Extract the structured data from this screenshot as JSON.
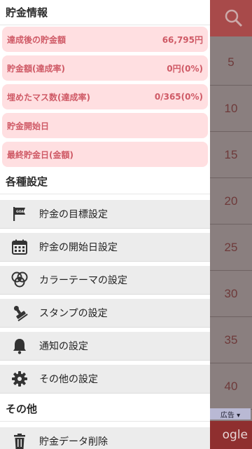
{
  "background": {
    "numbers": [
      "5",
      "10",
      "15",
      "20",
      "25",
      "30",
      "35",
      "40"
    ],
    "ad_label": "広告 ▾",
    "google_text": "ogle"
  },
  "savings_info": {
    "title": "貯金情報",
    "rows": [
      {
        "label": "達成後の貯金額",
        "value": "66,795円"
      },
      {
        "label": "貯金額(達成率)",
        "value": "0円(0%)"
      },
      {
        "label": "埋めたマス数(達成率)",
        "value": "0/365(0%)"
      },
      {
        "label": "貯金開始日",
        "value": ""
      },
      {
        "label": "最終貯金日(金額)",
        "value": ""
      }
    ]
  },
  "settings": {
    "title": "各種設定",
    "items": [
      {
        "label": "貯金の目標設定",
        "icon": "goal-flag-icon"
      },
      {
        "label": "貯金の開始日設定",
        "icon": "calendar-icon"
      },
      {
        "label": "カラーテーマの設定",
        "icon": "color-palette-icon"
      },
      {
        "label": "スタンプの設定",
        "icon": "stamp-icon"
      },
      {
        "label": "通知の設定",
        "icon": "bell-icon"
      },
      {
        "label": "その他の設定",
        "icon": "gear-icon"
      }
    ]
  },
  "other": {
    "title": "その他",
    "items": [
      {
        "label": "貯金データ削除",
        "icon": "trash-icon"
      }
    ]
  }
}
